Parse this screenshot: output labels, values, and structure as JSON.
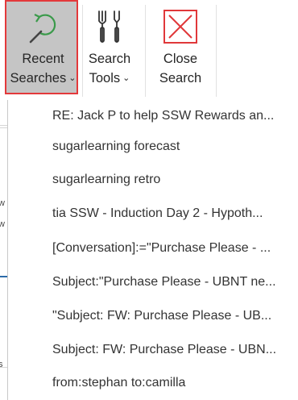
{
  "ribbon": {
    "recent_searches": {
      "line1": "Recent",
      "line2": "Searches",
      "chevron": "⌄",
      "icon": "recent-searches-icon"
    },
    "search_tools": {
      "line1": "Search",
      "line2": "Tools",
      "chevron": "⌄",
      "icon": "search-tools-icon"
    },
    "close_search": {
      "line1": "Close",
      "line2": "Search",
      "icon": "close-search-icon"
    }
  },
  "recent_menu": {
    "items": [
      "RE: Jack P to help SSW Rewards an...",
      "sugarlearning forecast",
      "sugarlearning retro",
      "tia SSW - Induction Day 2 - Hypoth...",
      "[Conversation]:=\"Purchase Please - ...",
      "Subject:\"Purchase Please - UBNT ne...",
      "\"Subject: FW: Purchase Please - UB...",
      "Subject: FW: Purchase Please - UBN...",
      "from:stephan to:camilla"
    ]
  },
  "background_marks": {
    "mark1": "w",
    "mark2": "w",
    "mark3": "s"
  },
  "colors": {
    "highlight_border": "#e3393b",
    "highlight_fill": "#c5c5c5",
    "recent_icon": "#3a9a4a",
    "close_icon": "#e0383a",
    "accent_line": "#2b6aa8"
  }
}
